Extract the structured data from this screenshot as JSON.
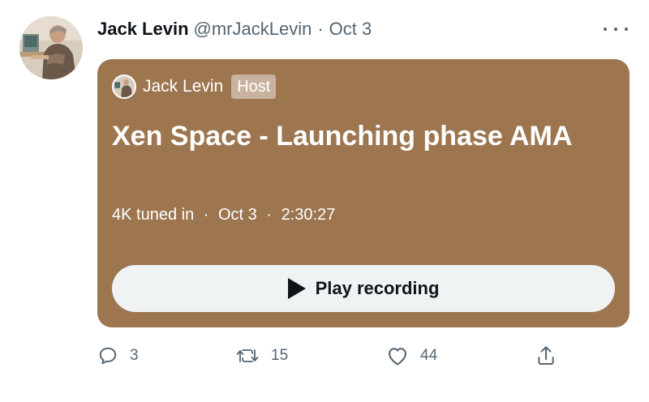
{
  "tweet": {
    "author": {
      "display_name": "Jack Levin",
      "handle": "@mrJackLevin",
      "separator": "·",
      "date": "Oct 3"
    },
    "space": {
      "host_name": "Jack Levin",
      "host_badge": "Host",
      "title": "Xen Space - Launching phase AMA",
      "listeners": "4K tuned in",
      "date": "Oct 3",
      "duration": "2:30:27",
      "separator": "·",
      "play_label": "Play recording",
      "card_color": "#9d7650"
    },
    "actions": {
      "replies": "3",
      "retweets": "15",
      "likes": "44"
    },
    "icons": {
      "more": "more-horizontal-icon",
      "reply": "reply-icon",
      "retweet": "retweet-icon",
      "like": "heart-icon",
      "share": "share-icon",
      "play": "play-icon"
    }
  }
}
